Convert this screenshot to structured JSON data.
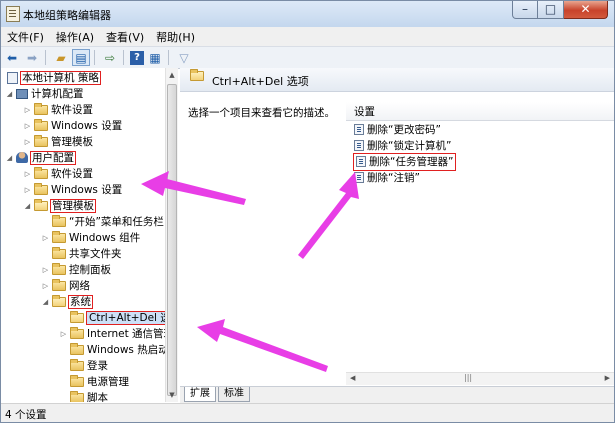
{
  "window": {
    "title": "本地组策略编辑器",
    "icon": "policy-editor-icon",
    "controls": {
      "minimize": "–",
      "maximize": "□",
      "close": "✕"
    }
  },
  "menu": [
    "文件(F)",
    "操作(A)",
    "查看(V)",
    "帮助(H)"
  ],
  "toolbar": [
    "back-arrow-icon",
    "forward-arrow-icon",
    "up-folder-icon",
    "show-hide-tree-icon",
    "export-icon",
    "help-icon",
    "properties-icon",
    "filter-icon"
  ],
  "tree": {
    "items": [
      {
        "label": "本地计算机 策略",
        "icon": "policy-icon"
      },
      {
        "label": "计算机配置",
        "icon": "computer-icon"
      },
      {
        "label": "软件设置",
        "icon": "folder-icon"
      },
      {
        "label": "Windows 设置",
        "icon": "folder-icon"
      },
      {
        "label": "管理模板",
        "icon": "folder-icon"
      },
      {
        "label": "用户配置",
        "icon": "user-icon"
      },
      {
        "label": "软件设置",
        "icon": "folder-icon"
      },
      {
        "label": "Windows 设置",
        "icon": "folder-icon"
      },
      {
        "label": "管理模板",
        "icon": "folder-icon"
      },
      {
        "label": "“开始”菜单和任务栏",
        "icon": "folder-icon"
      },
      {
        "label": "Windows 组件",
        "icon": "folder-icon"
      },
      {
        "label": "共享文件夹",
        "icon": "folder-icon"
      },
      {
        "label": "控制面板",
        "icon": "folder-icon"
      },
      {
        "label": "网络",
        "icon": "folder-icon"
      },
      {
        "label": "系统",
        "icon": "folder-icon"
      },
      {
        "label": "Ctrl+Alt+Del 选项",
        "icon": "folder-icon"
      },
      {
        "label": "Internet 通信管理",
        "icon": "folder-icon"
      },
      {
        "label": "Windows 热启动",
        "icon": "folder-icon"
      },
      {
        "label": "登录",
        "icon": "folder-icon"
      },
      {
        "label": "电源管理",
        "icon": "folder-icon"
      },
      {
        "label": "脚本",
        "icon": "folder-icon"
      }
    ]
  },
  "right": {
    "header": "Ctrl+Alt+Del 选项",
    "description": "选择一个项目来查看它的描述。",
    "column": "设置",
    "items": [
      "删除“更改密码”",
      "删除“锁定计算机”",
      "删除“任务管理器”",
      "删除“注销”"
    ],
    "hscroll_grip": "|||",
    "tabs": [
      "扩展",
      "标准"
    ]
  },
  "status": "4 个设置",
  "colors": {
    "highlight_box": "#e02020",
    "arrow": "#e83ee6",
    "selection": "#cde0f7",
    "title_bar": "#c4d7ee"
  }
}
